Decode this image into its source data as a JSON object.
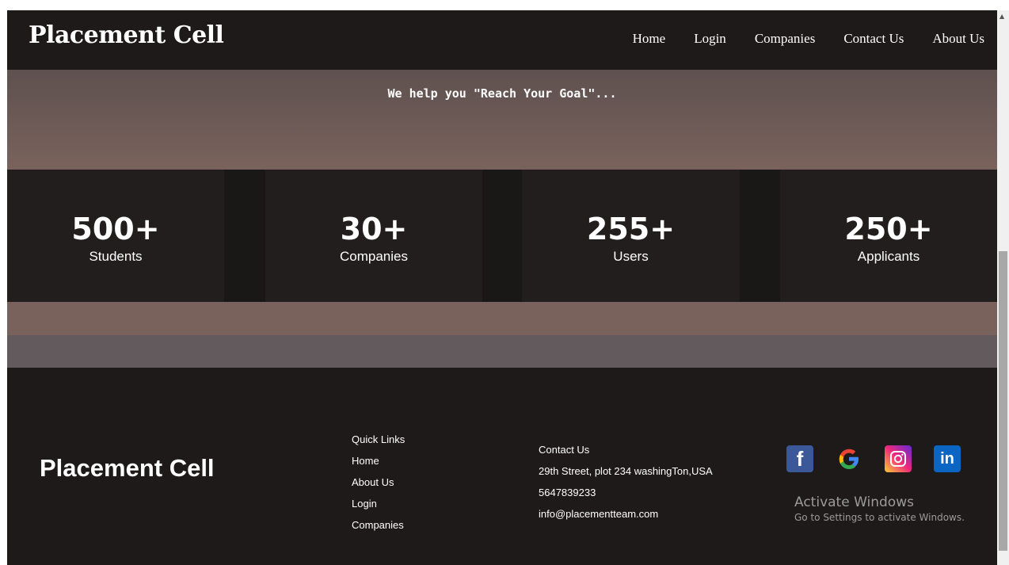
{
  "brand": "Placement Cell",
  "nav": [
    "Home",
    "Login",
    "Companies",
    "Contact Us",
    "About Us"
  ],
  "hero": {
    "tagline": "We help you \"Reach Your Goal\"..."
  },
  "stats": [
    {
      "value": "500+",
      "label": "Students"
    },
    {
      "value": "30+",
      "label": "Companies"
    },
    {
      "value": "255+",
      "label": "Users"
    },
    {
      "value": "250+",
      "label": "Applicants"
    }
  ],
  "footer": {
    "brand": "Placement Cell",
    "quick_links": [
      "Quick Links",
      "Home",
      "About Us",
      "Login",
      "Companies"
    ],
    "contact": [
      "Contact Us",
      "29th Street, plot 234 washingTon,USA",
      "5647839233",
      "info@placementteam.com"
    ],
    "social_icons": [
      "facebook-icon",
      "google-icon",
      "instagram-icon",
      "linkedin-icon"
    ]
  },
  "watermark": {
    "title": "Activate Windows",
    "subtitle": "Go to Settings to activate Windows."
  },
  "colors": {
    "background": "#1e1a1a",
    "hero_start": "#5e514f",
    "hero_end": "#7a625c",
    "band": "#7a625c",
    "band_gray": "#625a5c"
  }
}
